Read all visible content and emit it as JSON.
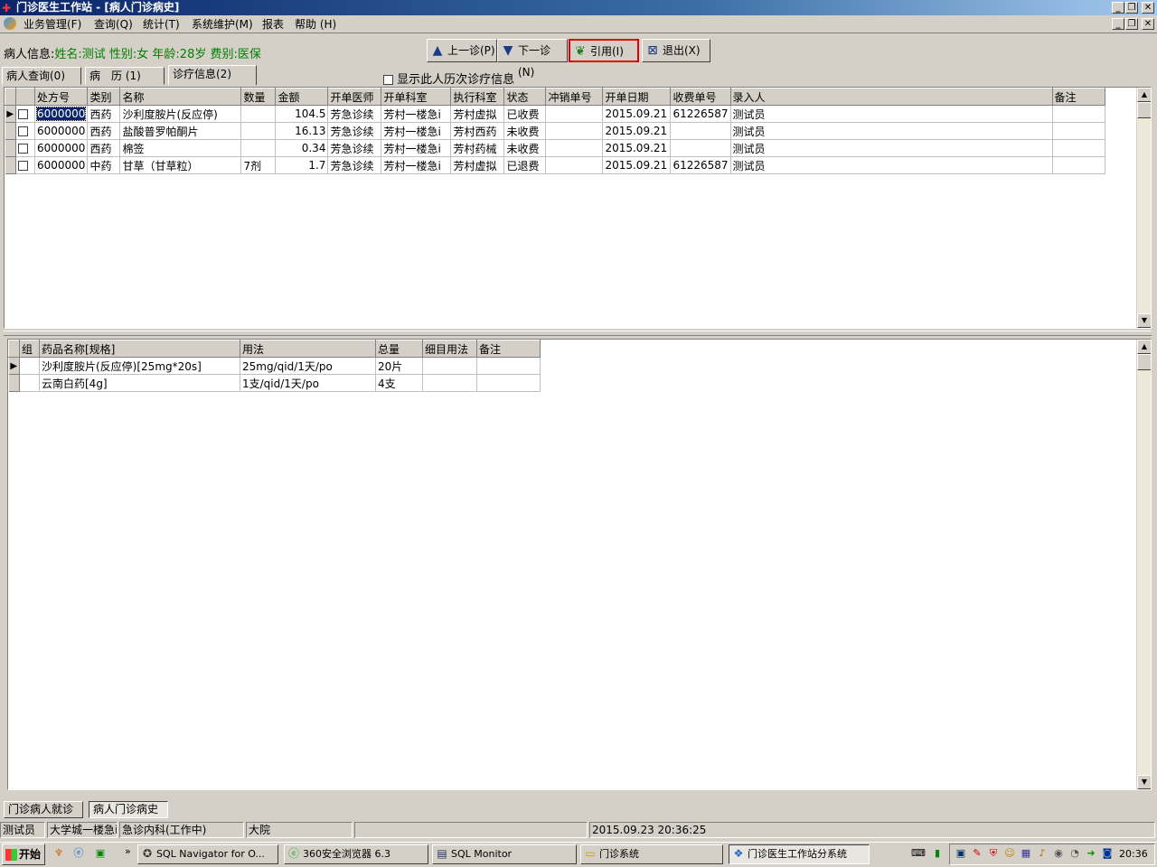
{
  "window": {
    "title": "门诊医生工作站 - [病人门诊病史]"
  },
  "menu": [
    "业务管理(F)",
    "查询(Q)",
    "统计(T)",
    "系统维护(M)",
    "报表",
    "帮助 (H)"
  ],
  "patient": {
    "label": "病人信息:",
    "detail": "姓名:测试 性别:女 年龄:28岁 费别:医保"
  },
  "toolbar": {
    "prev": "上一诊(P)",
    "next": "下一诊(N)",
    "cite": "引用(I)",
    "exit": "退出(X)"
  },
  "tabs": [
    "病人查询(0)",
    "病　历 (1)",
    "诊疗信息(2)"
  ],
  "history_checkbox": "显示此人历次诊疗信息",
  "main_table": {
    "headers": [
      "处方号",
      "类别",
      "名称",
      "数量",
      "金额",
      "开单医师",
      "开单科室",
      "执行科室",
      "状态",
      "冲销单号",
      "开单日期",
      "收费单号",
      "录入人",
      "备注"
    ],
    "rows": [
      [
        "6000000",
        "西药",
        "沙利度胺片(反应停)",
        "",
        "104.5",
        "芳急诊续",
        "芳村一楼急i",
        "芳村虚拟",
        "已收费",
        "",
        "2015.09.21",
        "61226587",
        "测试员",
        ""
      ],
      [
        "6000000",
        "西药",
        "盐酸普罗帕酮片",
        "",
        "16.13",
        "芳急诊续",
        "芳村一楼急i",
        "芳村西药",
        "未收费",
        "",
        "2015.09.21",
        "",
        "测试员",
        ""
      ],
      [
        "6000000",
        "西药",
        "棉签",
        "",
        "0.34",
        "芳急诊续",
        "芳村一楼急i",
        "芳村药械",
        "未收费",
        "",
        "2015.09.21",
        "",
        "测试员",
        ""
      ],
      [
        "6000000",
        "中药",
        "甘草（甘草粒）",
        "7剂",
        "1.7",
        "芳急诊续",
        "芳村一楼急i",
        "芳村虚拟",
        "已退费",
        "",
        "2015.09.21",
        "61226587",
        "测试员",
        ""
      ]
    ]
  },
  "detail_table": {
    "headers": [
      "组",
      "药品名称[规格]",
      "用法",
      "总量",
      "细目用法",
      "备注"
    ],
    "rows": [
      [
        "",
        "沙利度胺片(反应停)[25mg*20s]",
        "25mg/qid/1天/po",
        "20片",
        "",
        ""
      ],
      [
        "",
        "云南白药[4g]",
        "1支/qid/1天/po",
        "4支",
        "",
        ""
      ]
    ]
  },
  "bottom_tabs": [
    "门诊病人就诊",
    "病人门诊病史"
  ],
  "status": [
    "测试员",
    "大学城一楼急i",
    "急诊内科(工作中)",
    "大院",
    "",
    "2015.09.23 20:36:25"
  ],
  "taskbar": {
    "start": "开始",
    "tasks": [
      "SQL Navigator for O...",
      "360安全浏览器 6.3",
      "SQL Monitor",
      "门诊系统",
      "门诊医生工作站分系统"
    ],
    "clock": "20:36"
  }
}
